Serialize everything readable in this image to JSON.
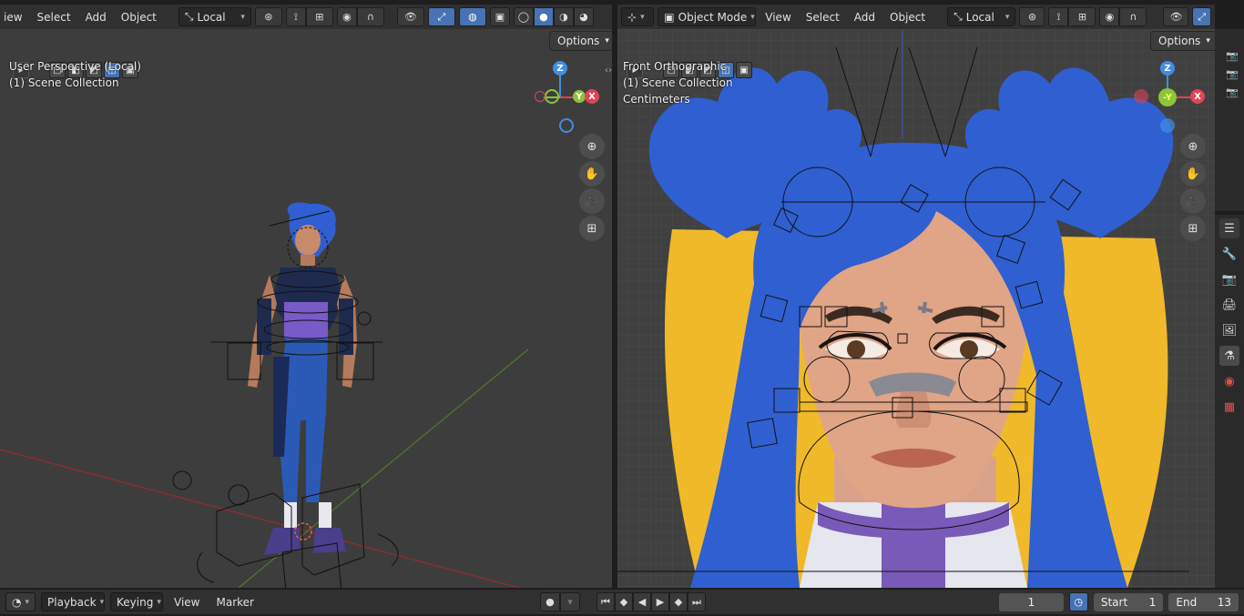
{
  "left_header": {
    "menus": [
      "iew",
      "Select",
      "Add",
      "Object"
    ],
    "orientation": "Local"
  },
  "right_header": {
    "mode": "Object Mode",
    "menus": [
      "View",
      "Select",
      "Add",
      "Object"
    ],
    "orientation": "Local"
  },
  "left_viewport": {
    "view_name": "User Perspective (Local)",
    "collection": "(1) Scene Collection",
    "options_label": "Options",
    "axes": {
      "z": "Z",
      "y": "Y",
      "x": "X"
    }
  },
  "right_viewport": {
    "view_name": "Front Orthographic",
    "collection": "(1) Scene Collection",
    "units": "Centimeters",
    "options_label": "Options",
    "axes": {
      "z": "Z",
      "y": "-Y",
      "x": "X"
    }
  },
  "timeline": {
    "menus": [
      "Playback",
      "Keying",
      "View",
      "Marker"
    ],
    "current_frame": "1",
    "start_label": "Start",
    "start_value": "1",
    "end_label": "End",
    "end_value": "13"
  },
  "colors": {
    "accent": "#4772b3",
    "x_axis": "#e04455",
    "y_axis": "#8cc43b",
    "z_axis": "#3f8ee5",
    "viewport_bg": "#3d3d3d",
    "hair_blue": "#2f5fd0",
    "hair_yellow": "#f0b92a"
  },
  "icons": {
    "properties": [
      "tool-icon",
      "render-icon",
      "output-icon",
      "view-layer-icon",
      "scene-icon",
      "world-icon",
      "texture-icon"
    ]
  }
}
